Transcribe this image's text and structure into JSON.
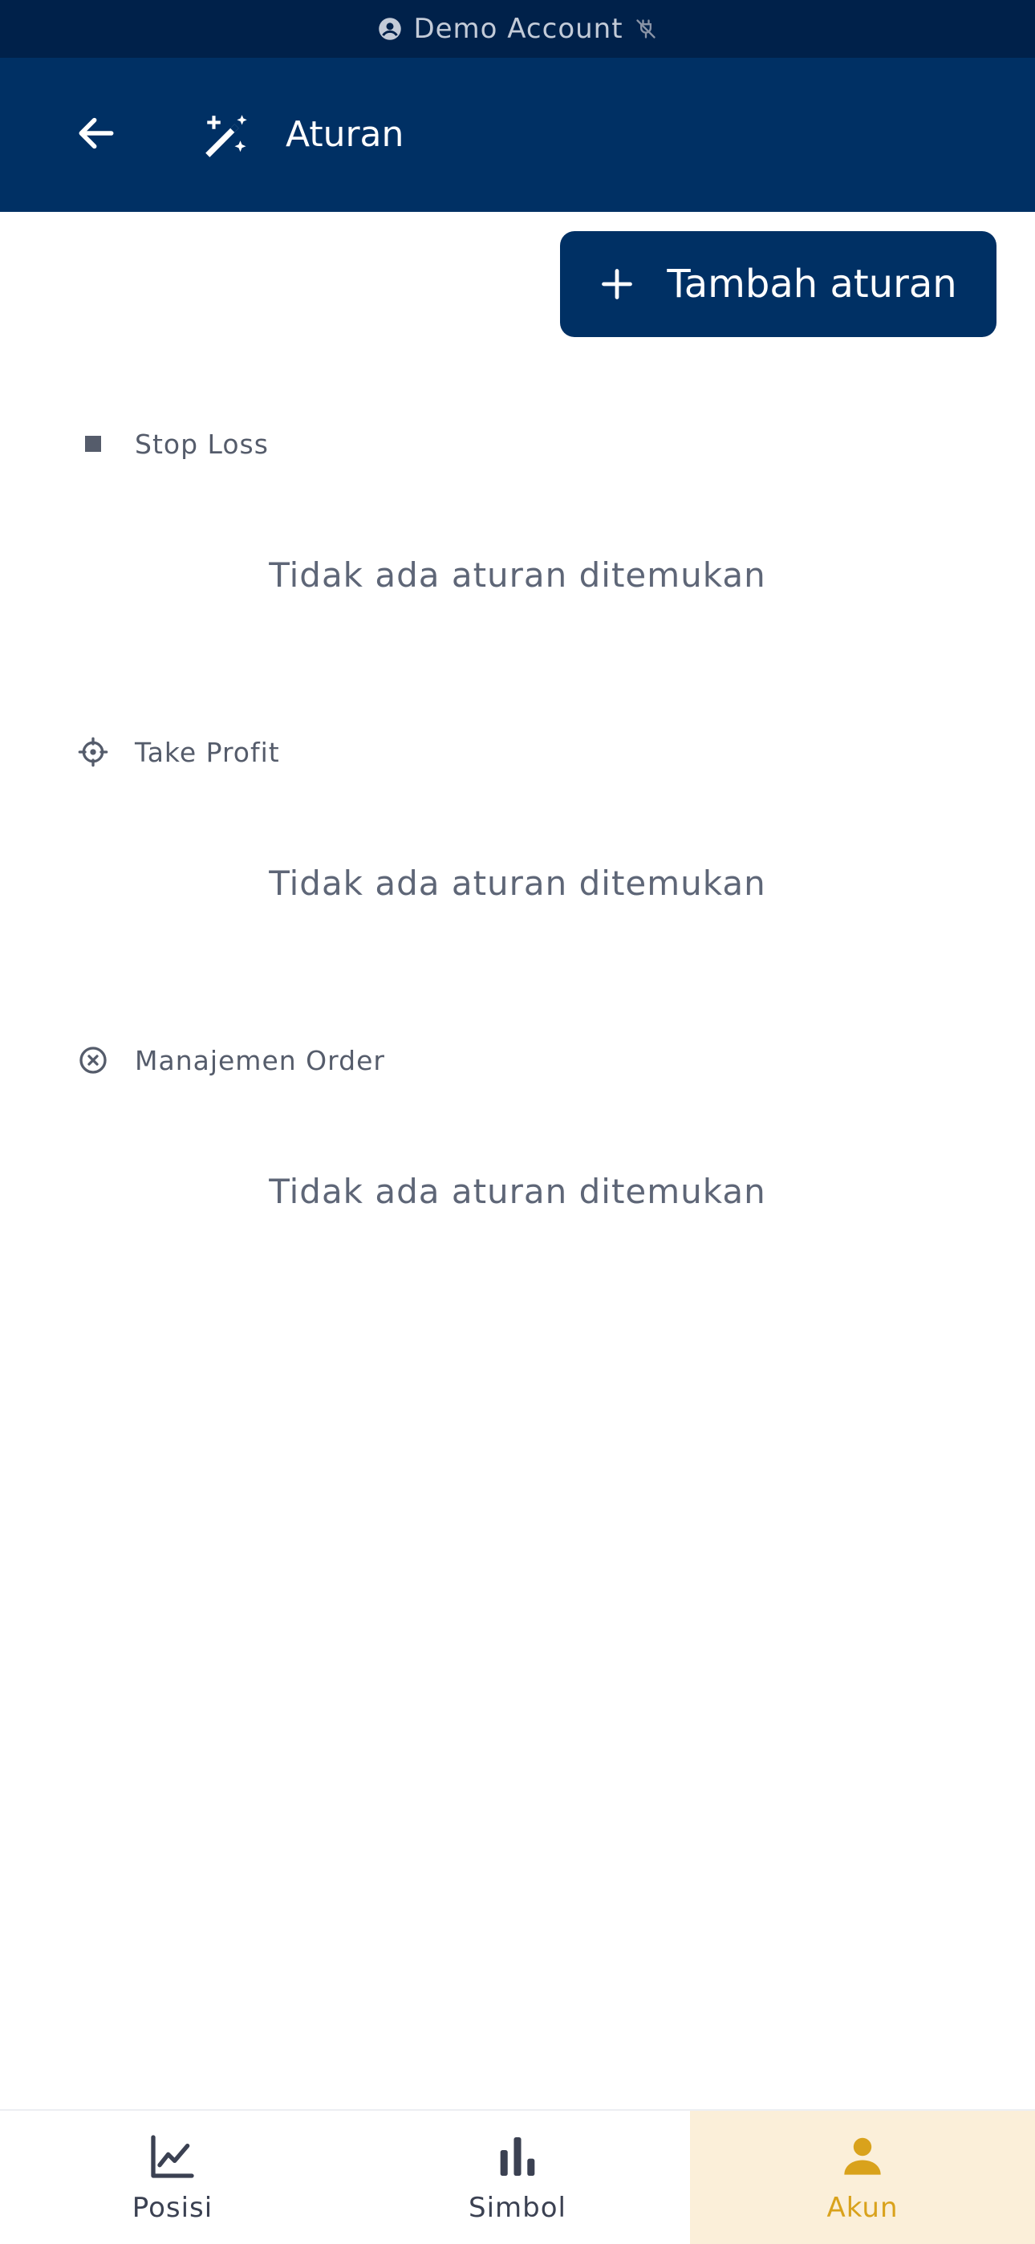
{
  "banner": {
    "text": "Demo Account",
    "icon_left": "account-circle-icon",
    "icon_right": "plug-off-icon"
  },
  "header": {
    "title": "Aturan",
    "back_icon": "arrow-left-icon",
    "title_icon": "magic-wand-icon"
  },
  "actions": {
    "add_rule_label": "Tambah aturan",
    "add_icon": "plus-icon"
  },
  "sections": [
    {
      "title": "Stop Loss",
      "icon": "square-stop-icon",
      "empty_text": "Tidak ada aturan ditemukan"
    },
    {
      "title": "Take Profit",
      "icon": "crosshair-icon",
      "empty_text": "Tidak ada aturan ditemukan"
    },
    {
      "title": "Manajemen Order",
      "icon": "x-circle-icon",
      "empty_text": "Tidak ada aturan ditemukan"
    }
  ],
  "nav": {
    "items": [
      {
        "label": "Posisi",
        "icon": "line-chart-icon",
        "active": false
      },
      {
        "label": "Simbol",
        "icon": "bar-chart-icon",
        "active": false
      },
      {
        "label": "Akun",
        "icon": "user-icon",
        "active": true
      }
    ]
  },
  "colors": {
    "banner_bg": "#00214a",
    "primary": "#003064",
    "accent": "#d9a21c",
    "active_nav_bg": "#fbefd9",
    "muted_text": "#5e6677"
  }
}
